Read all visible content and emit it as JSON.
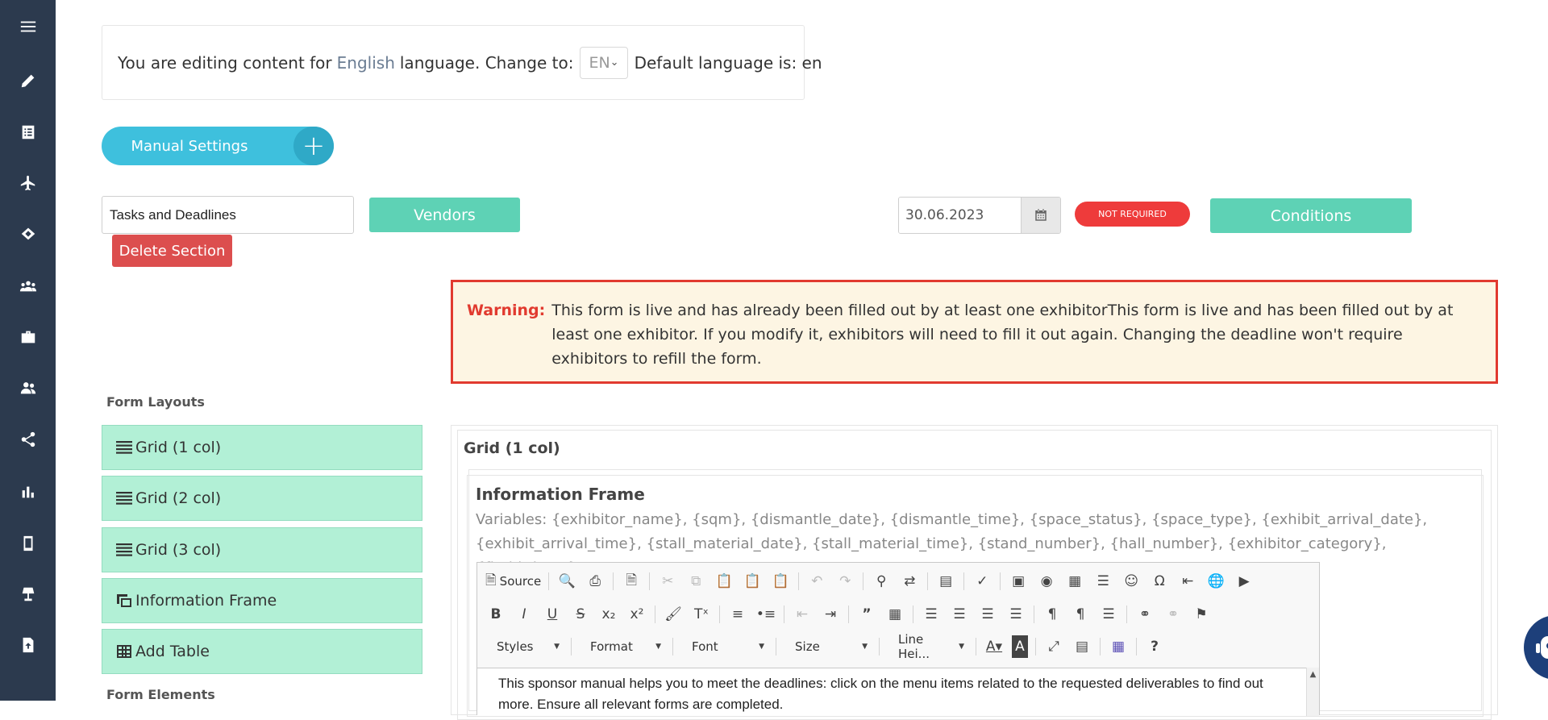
{
  "sidebar": {
    "items": [
      {
        "icon": "menu-icon"
      },
      {
        "icon": "pencil-icon"
      },
      {
        "icon": "list-icon"
      },
      {
        "icon": "plane-icon"
      },
      {
        "icon": "handshake-icon"
      },
      {
        "icon": "users-icon"
      },
      {
        "icon": "briefcase-icon"
      },
      {
        "icon": "user-group-icon"
      },
      {
        "icon": "share-icon"
      },
      {
        "icon": "bar-chart-icon"
      },
      {
        "icon": "mobile-icon"
      },
      {
        "icon": "lamp-icon"
      },
      {
        "icon": "file-upload-icon"
      }
    ]
  },
  "language": {
    "prefix": "You are editing content for",
    "current": "English",
    "middle": "language. Change to:",
    "selected": "EN",
    "suffix": "Default language is: en"
  },
  "manual_settings": {
    "label": "Manual Settings",
    "plus": "+"
  },
  "section": {
    "name_value": "Tasks and Deadlines",
    "vendors_label": "Vendors",
    "delete_label": "Delete Section",
    "deadline": "30.06.2023",
    "status_badge": "NOT REQUIRED",
    "conditions_label": "Conditions"
  },
  "warning": {
    "label": "Warning:",
    "text": "This form is live and has already been filled out by at least one exhibitorThis form is live and has been filled out by at least one exhibitor. If you modify it, exhibitors will need to fill it out again. Changing the deadline won't require exhibitors to refill the form."
  },
  "layouts": {
    "title": "Form Layouts",
    "items": [
      {
        "label": "Grid (1 col)",
        "icon": "grid-lines-icon"
      },
      {
        "label": "Grid (2 col)",
        "icon": "grid-lines-icon"
      },
      {
        "label": "Grid (3 col)",
        "icon": "grid-lines-icon"
      },
      {
        "label": "Information Frame",
        "icon": "info-frame-icon"
      },
      {
        "label": "Add Table",
        "icon": "table-icon"
      }
    ],
    "elements_title": "Form Elements"
  },
  "grid": {
    "title": "Grid (1 col)",
    "frame_title": "Information Frame",
    "variables": "Variables: {exhibitor_name}, {sqm}, {dismantle_date}, {dismantle_time}, {space_status}, {space_type}, {exhibit_arrival_date}, {exhibit_arrival_time}, {stall_material_date}, {stall_material_time}, {stand_number}, {hall_number}, {exhibitor_category}, {firebird_sso}"
  },
  "editor": {
    "source_label": "Source",
    "combos": [
      "Styles",
      "Format",
      "Font",
      "Size",
      "Line Hei..."
    ],
    "body": "This sponsor manual helps you to meet the deadlines: click on the menu items related to the requested deliverables to find out more. Ensure all relevant forms are completed."
  }
}
